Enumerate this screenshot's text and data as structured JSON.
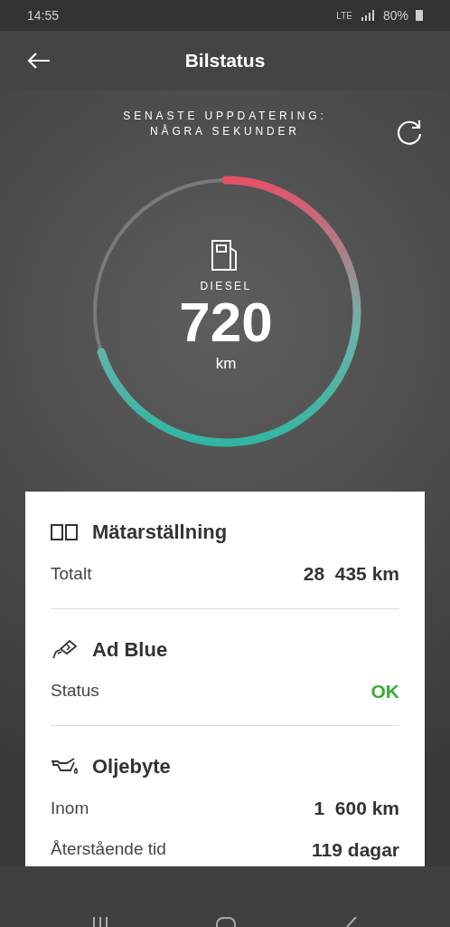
{
  "status_bar": {
    "time": "14:55",
    "network": "LTE",
    "battery": "80%"
  },
  "header": {
    "title": "Bilstatus"
  },
  "update": {
    "label": "SENASTE UPPDATERING:",
    "value": "NÅGRA SEKUNDER"
  },
  "gauge": {
    "fuel": "DIESEL",
    "range": "720",
    "unit": "km"
  },
  "sections": [
    {
      "kind": "odometer",
      "title": "Mätarställning",
      "rows": [
        {
          "label": "Totalt",
          "value": "28  435 km",
          "kind": "reading"
        }
      ]
    },
    {
      "kind": "adblue",
      "title": "Ad Blue",
      "rows": [
        {
          "label": "Status",
          "value": "OK",
          "kind": "ok"
        }
      ]
    },
    {
      "kind": "oil",
      "title": "Oljebyte",
      "rows": [
        {
          "label": "Inom",
          "value": "1  600 km",
          "kind": "reading"
        },
        {
          "label": "Återstående tid",
          "value": "119 dagar",
          "kind": "reading"
        }
      ]
    }
  ]
}
